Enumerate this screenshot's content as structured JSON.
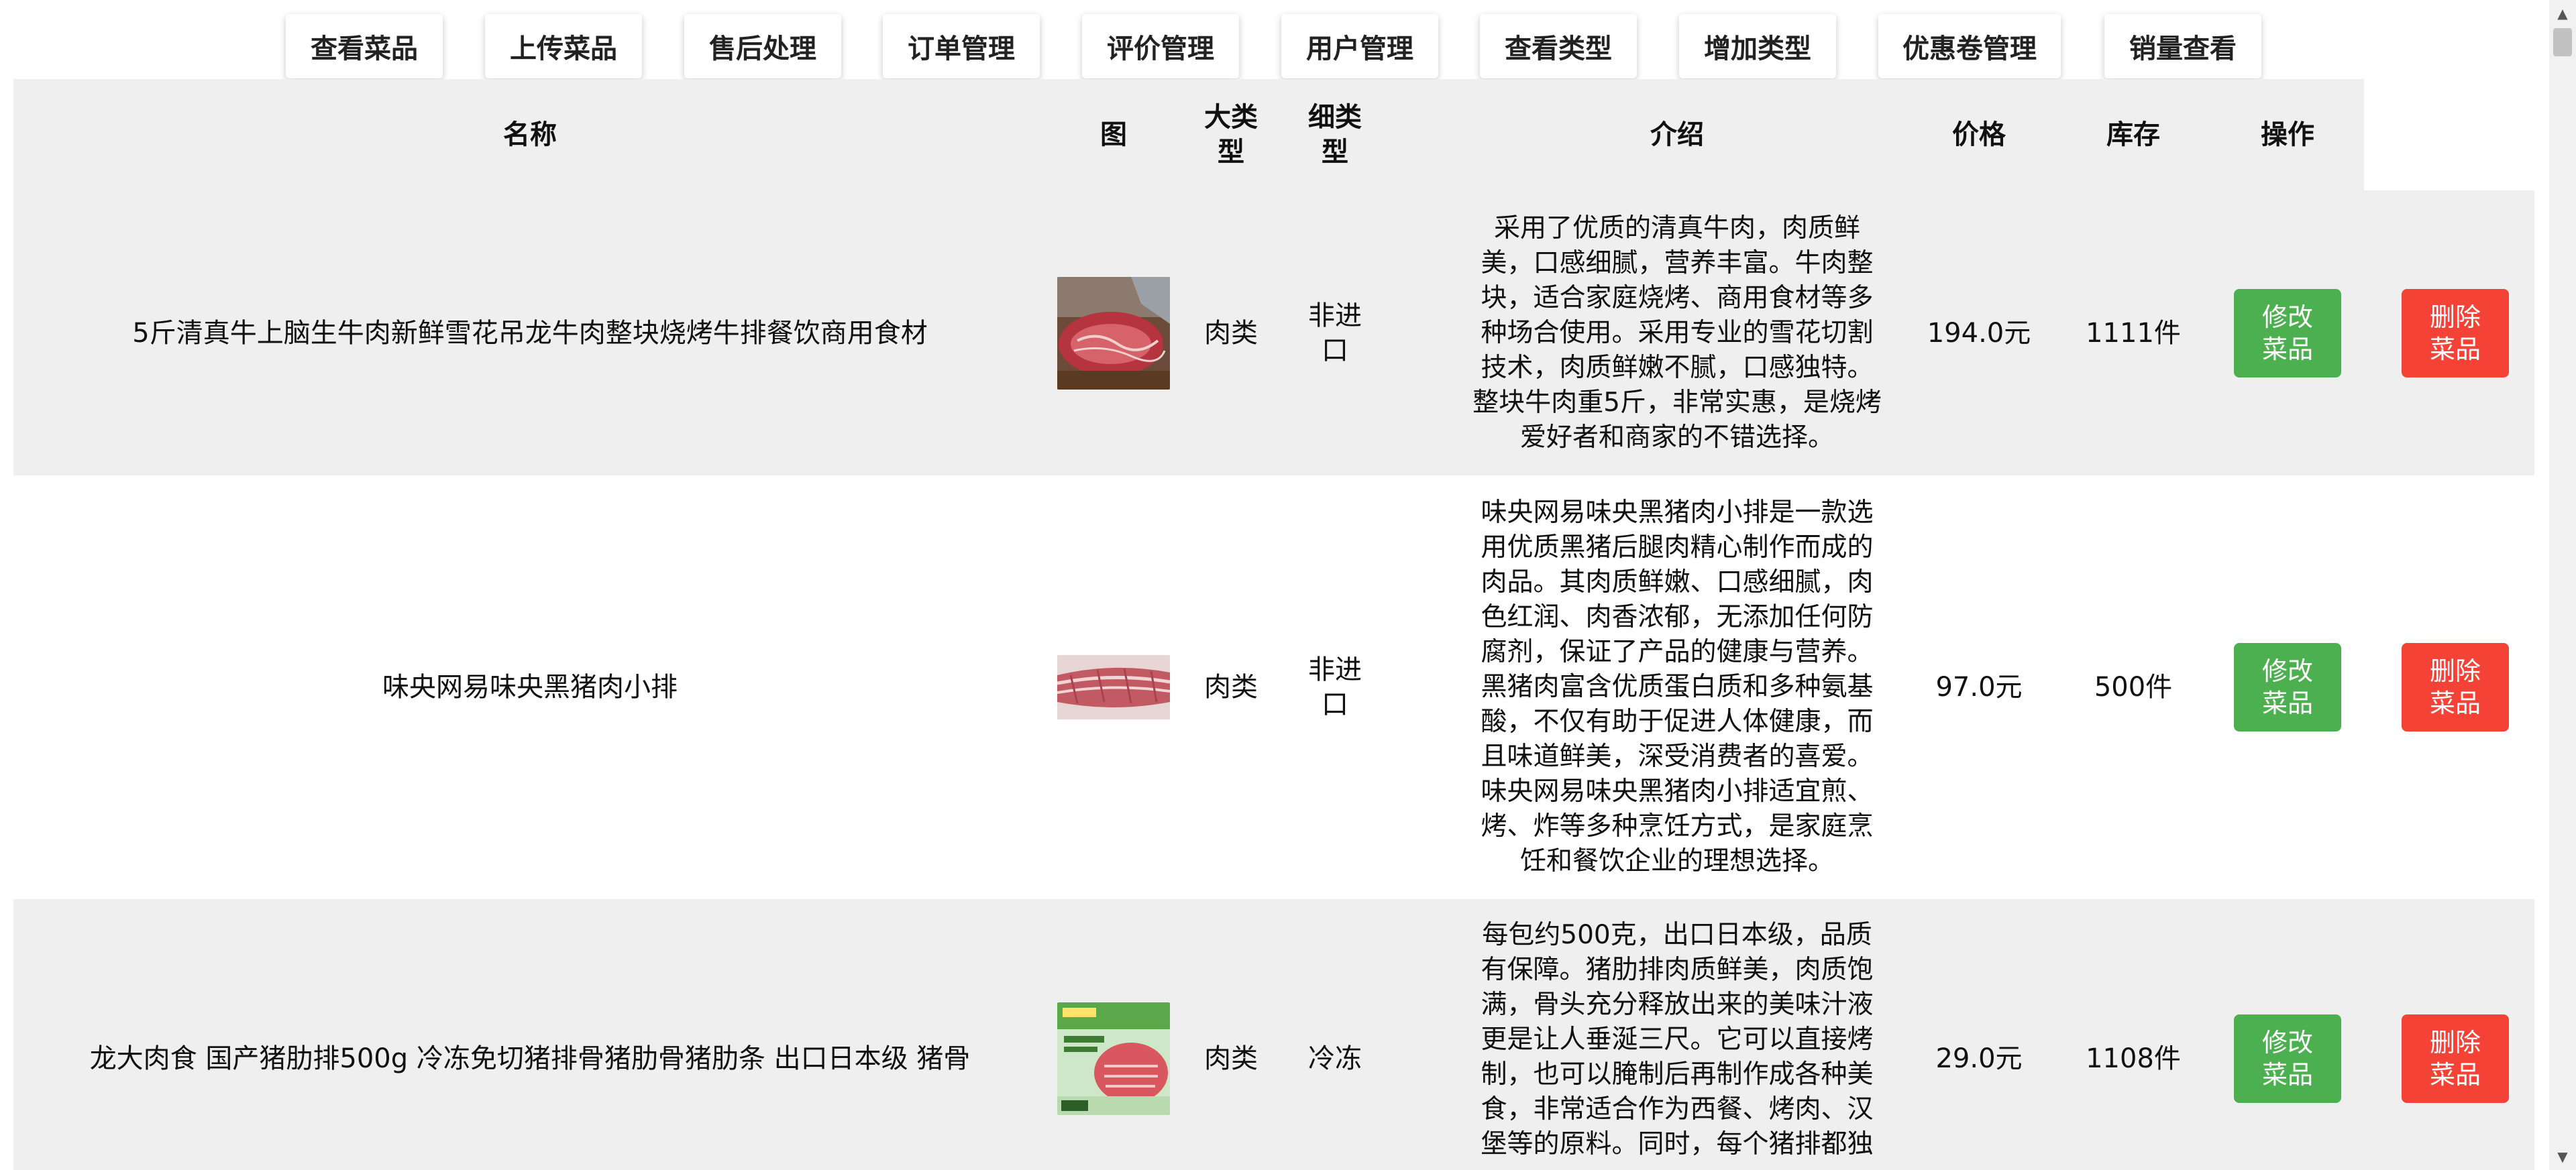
{
  "nav": [
    {
      "label": "查看菜品"
    },
    {
      "label": "上传菜品"
    },
    {
      "label": "售后处理"
    },
    {
      "label": "订单管理"
    },
    {
      "label": "评价管理"
    },
    {
      "label": "用户管理"
    },
    {
      "label": "查看类型"
    },
    {
      "label": "增加类型"
    },
    {
      "label": "优惠卷管理"
    },
    {
      "label": "销量查看"
    }
  ],
  "table": {
    "headers": {
      "name": "名称",
      "image": "图",
      "category": "大类\n型",
      "subcategory": "细类\n型",
      "description": "介绍",
      "price": "价格",
      "stock": "库存",
      "actions": "操作"
    },
    "rows": [
      {
        "name": "5斤清真牛上脑生牛肉新鲜雪花吊龙牛肉整块烧烤牛排餐饮商用食材",
        "image_icon": "beef-photo",
        "category": "肉类",
        "subcategory": "非进\n口",
        "description": "采用了优质的清真牛肉，肉质鲜\n美，口感细腻，营养丰富。牛肉整\n块，适合家庭烧烤、商用食材等多\n种场合使用。采用专业的雪花切割\n技术，肉质鲜嫩不腻，口感独特。\n整块牛肉重5斤，非常实惠，是烧烤\n爱好者和商家的不错选择。",
        "price": "194.0元",
        "stock": "1111件",
        "edit_label": "修改\n菜品",
        "delete_label": "删除\n菜品"
      },
      {
        "name": "味央网易味央黑猪肉小排",
        "image_icon": "pork-ribs-photo",
        "category": "肉类",
        "subcategory": "非进\n口",
        "description": "味央网易味央黑猪肉小排是一款选\n用优质黑猪后腿肉精心制作而成的\n肉品。其肉质鲜嫩、口感细腻，肉\n色红润、肉香浓郁，无添加任何防\n腐剂，保证了产品的健康与营养。\n黑猪肉富含优质蛋白质和多种氨基\n酸，不仅有助于促进人体健康，而\n且味道鲜美，深受消费者的喜爱。\n味央网易味央黑猪肉小排适宜煎、\n烤、炸等多种烹饪方式，是家庭烹\n饪和餐饮企业的理想选择。",
        "price": "97.0元",
        "stock": "500件",
        "edit_label": "修改\n菜品",
        "delete_label": "删除\n菜品"
      },
      {
        "name": "龙大肉食 国产猪肋排500g 冷冻免切猪排骨猪肋骨猪肋条 出口日本级 猪骨",
        "image_icon": "packaged-ribs-photo",
        "category": "肉类",
        "subcategory": "冷冻",
        "description": "每包约500克，出口日本级，品质\n有保障。猪肋排肉质鲜美，肉质饱\n满，骨头充分释放出来的美味汁液\n更是让人垂涎三尺。它可以直接烤\n制，也可以腌制后再制作成各种美\n食，非常适合作为西餐、烤肉、汉\n堡等的原料。同时，每个猪排都独",
        "price": "29.0元",
        "stock": "1108件",
        "edit_label": "修改\n菜品",
        "delete_label": "删除\n菜品"
      }
    ]
  },
  "colors": {
    "edit_button": "#4caf50",
    "delete_button": "#f44336",
    "row_alt": "#efefef"
  }
}
